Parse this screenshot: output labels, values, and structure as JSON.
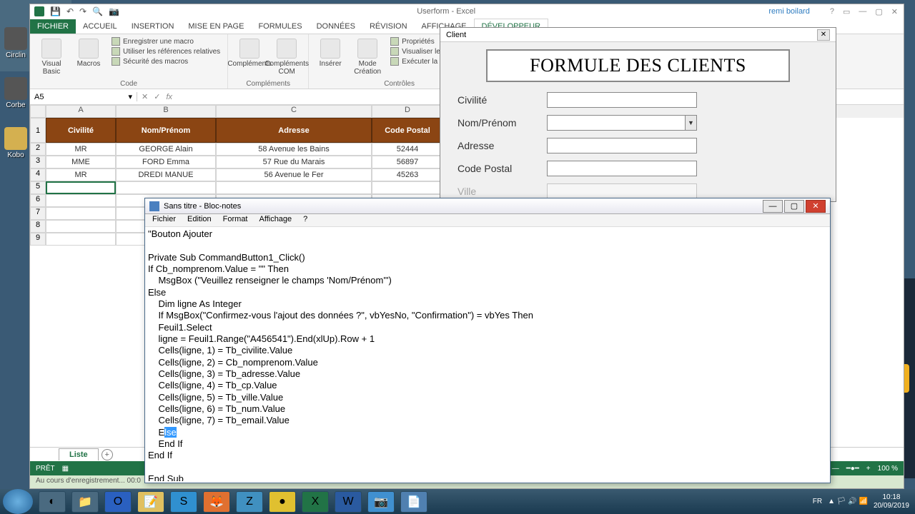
{
  "excel": {
    "title": "Userform - Excel",
    "user": "remi boilard",
    "tabs": [
      "FICHIER",
      "ACCUEIL",
      "INSERTION",
      "MISE EN PAGE",
      "FORMULES",
      "DONNÉES",
      "RÉVISION",
      "AFFICHAGE",
      "DÉVELOPPEUR"
    ],
    "active_tab": "DÉVELOPPEUR",
    "ribbon": {
      "code": {
        "vb": "Visual Basic",
        "macros": "Macros",
        "rec": "Enregistrer une macro",
        "rel": "Utiliser les références relatives",
        "sec": "Sécurité des macros",
        "label": "Code"
      },
      "compl": {
        "b1": "Compléments",
        "b2": "Compléments COM",
        "label": "Compléments"
      },
      "ctrl": {
        "ins": "Insérer",
        "mode": "Mode Création",
        "prop": "Propriétés",
        "view": "Visualiser le code",
        "exec": "Exécuter la boîte de dialo",
        "label": "Contrôles"
      }
    },
    "namebox": "A5",
    "columns": [
      "A",
      "B",
      "C",
      "D"
    ],
    "headers": [
      "Civilité",
      "Nom/Prénom",
      "Adresse",
      "Code Postal"
    ],
    "rows": [
      [
        "MR",
        "GEORGE Alain",
        "58 Avenue les Bains",
        "52444"
      ],
      [
        "MME",
        "FORD Emma",
        "57 Rue du Marais",
        "56897"
      ],
      [
        "MR",
        "DREDI MANUE",
        "56 Avenue le Fer",
        "45263"
      ]
    ],
    "sheet_tab": "Liste",
    "status": "PRÊT",
    "zoom": "100 %",
    "recording_msg": "Au cours d'enregistrement... 00:0"
  },
  "userform": {
    "title": "Client",
    "header": "FORMULE DES CLIENTS",
    "fields": [
      "Civilité",
      "Nom/Prénom",
      "Adresse",
      "Code Postal",
      "Ville"
    ]
  },
  "notepad": {
    "title": "Sans titre - Bloc-notes",
    "menu": [
      "Fichier",
      "Edition",
      "Format",
      "Affichage",
      "?"
    ],
    "line1": "\"Bouton Ajouter",
    "line2": "",
    "line3": "Private Sub CommandButton1_Click()",
    "line4": "If Cb_nomprenom.Value = \"\" Then",
    "line5": "    MsgBox (\"Veuillez renseigner le champs 'Nom/Prénom'\")",
    "line6": "Else",
    "line7": "    Dim ligne As Integer",
    "line8": "    If MsgBox(\"Confirmez-vous l'ajout des données ?\", vbYesNo, \"Confirmation\") = vbYes Then",
    "line9": "    Feuil1.Select",
    "line10": "    ligne = Feuil1.Range(\"A456541\").End(xlUp).Row + 1",
    "line11": "    Cells(ligne, 1) = Tb_civilite.Value",
    "line12": "    Cells(ligne, 2) = Cb_nomprenom.Value",
    "line13": "    Cells(ligne, 3) = Tb_adresse.Value",
    "line14": "    Cells(ligne, 4) = Tb_cp.Value",
    "line15": "    Cells(ligne, 5) = Tb_ville.Value",
    "line16": "    Cells(ligne, 6) = Tb_num.Value",
    "line17": "    Cells(ligne, 7) = Tb_email.Value",
    "line18a": "    E",
    "line18b": "lse",
    "line19": "    End If",
    "line20": "End If",
    "line21": "",
    "line22": "End Sub"
  },
  "desktop": {
    "i1": "Circlin",
    "i2": "Corbe",
    "i3": "Kobo"
  },
  "taskbar": {
    "time": "10:18",
    "date": "20/09/2019",
    "lang": "FR"
  }
}
